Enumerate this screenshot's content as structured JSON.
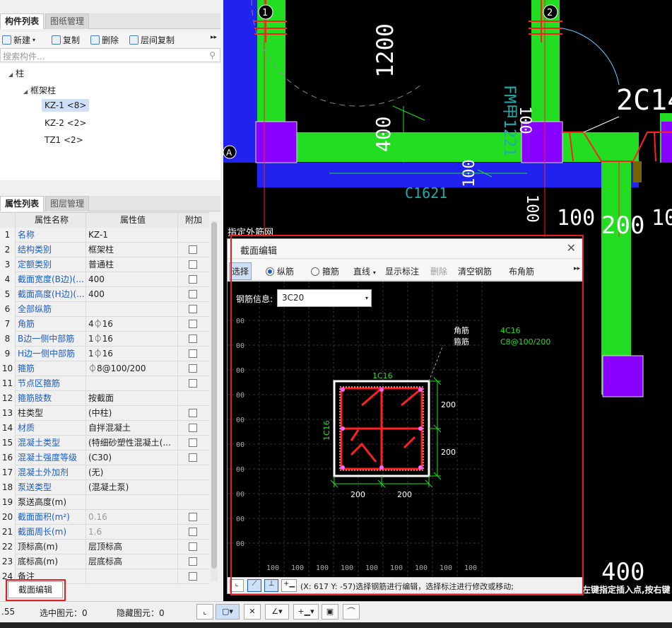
{
  "component_panel": {
    "tabs": [
      "构件列表",
      "图纸管理"
    ],
    "toolbar": {
      "new": "新建",
      "copy": "复制",
      "delete": "删除",
      "floor_copy": "层间复制"
    },
    "search_placeholder": "搜索构件...",
    "tree": {
      "root": "柱",
      "group": "框架柱",
      "items": [
        "KZ-1 <8>",
        "KZ-2 <2>",
        "TZ1 <2>"
      ]
    }
  },
  "property_panel": {
    "tabs": [
      "属性列表",
      "图层管理"
    ],
    "headers": [
      "属性名称",
      "属性值",
      "附加"
    ],
    "rows": [
      {
        "n": "1",
        "name": "名称",
        "value": "KZ-1",
        "blue": true,
        "chk": false
      },
      {
        "n": "2",
        "name": "结构类别",
        "value": "框架柱",
        "blue": true,
        "chk": true
      },
      {
        "n": "3",
        "name": "定额类别",
        "value": "普通柱",
        "blue": true,
        "chk": true
      },
      {
        "n": "4",
        "name": "截面宽度(B边)(...",
        "value": "400",
        "blue": true,
        "chk": true
      },
      {
        "n": "5",
        "name": "截面高度(H边)(...",
        "value": "400",
        "blue": true,
        "chk": true
      },
      {
        "n": "6",
        "name": "全部纵筋",
        "value": "",
        "blue": true,
        "chk": true
      },
      {
        "n": "7",
        "name": "角筋",
        "value": "4⏀16",
        "blue": true,
        "chk": true
      },
      {
        "n": "8",
        "name": "B边一侧中部筋",
        "value": "1⏀16",
        "blue": true,
        "chk": true
      },
      {
        "n": "9",
        "name": "H边一侧中部筋",
        "value": "1⏀16",
        "blue": true,
        "chk": true
      },
      {
        "n": "10",
        "name": "箍筋",
        "value": "⏀8@100/200",
        "blue": true,
        "chk": true
      },
      {
        "n": "11",
        "name": "节点区箍筋",
        "value": "",
        "blue": true,
        "chk": true
      },
      {
        "n": "12",
        "name": "箍筋肢数",
        "value": "按截面",
        "blue": true,
        "chk": false
      },
      {
        "n": "13",
        "name": "柱类型",
        "value": "(中柱)",
        "blue": false,
        "chk": true
      },
      {
        "n": "14",
        "name": "材质",
        "value": "自拌混凝土",
        "blue": true,
        "chk": true
      },
      {
        "n": "15",
        "name": "混凝土类型",
        "value": "(特细砂塑性混凝土(...",
        "blue": true,
        "chk": true
      },
      {
        "n": "16",
        "name": "混凝土强度等级",
        "value": "(C30)",
        "blue": true,
        "chk": true
      },
      {
        "n": "17",
        "name": "混凝土外加剂",
        "value": "(无)",
        "blue": true,
        "chk": false
      },
      {
        "n": "18",
        "name": "泵送类型",
        "value": "(混凝土泵)",
        "blue": true,
        "chk": false
      },
      {
        "n": "19",
        "name": "泵送高度(m)",
        "value": "",
        "blue": false,
        "chk": false
      },
      {
        "n": "20",
        "name": "截面面积(m²)",
        "value": "0.16",
        "blue": true,
        "chk": true,
        "gray": true
      },
      {
        "n": "21",
        "name": "截面周长(m)",
        "value": "1.6",
        "blue": true,
        "chk": true,
        "gray": true
      },
      {
        "n": "22",
        "name": "顶标高(m)",
        "value": "层顶标高",
        "blue": false,
        "chk": true
      },
      {
        "n": "23",
        "name": "底标高(m)",
        "value": "层底标高",
        "blue": false,
        "chk": true
      },
      {
        "n": "24",
        "name": "备注",
        "value": "",
        "blue": false,
        "chk": true
      }
    ],
    "footer_button": "截面编辑"
  },
  "status_bar": {
    "coord": ".55",
    "selected": "选中图元：0",
    "hidden": "隐藏图元：0"
  },
  "cad": {
    "axis_1": "1",
    "axis_2": "2",
    "axis_a": "A",
    "dim_1200": "1200",
    "label_fm": "FM甲1221",
    "label_2c14": "2C14",
    "dim_400": "400",
    "dim_100_a": "100",
    "dim_100_b": "100",
    "dim_100_c": "100",
    "label_c1621": "C1621",
    "dim_100_d": "100",
    "dim_200": "200",
    "dim_10": "10",
    "partial_text": "指定外筋网",
    "dim_400_b": "400",
    "status_text": "左键指定插入点,按右键"
  },
  "dialog": {
    "title": "截面编辑",
    "toolbar": {
      "select": "选择",
      "longitudinal": "纵筋",
      "stirrup": "箍筋",
      "line": "直线",
      "show_dims": "显示标注",
      "delete": "删除",
      "clear": "清空钢筋",
      "corner": "布角筋"
    },
    "rebar_info_label": "钢筋信息:",
    "rebar_info_value": "3C20",
    "legend_corner": "角筋",
    "legend_stirrup": "箍筋",
    "legend_corner_val": "4C16",
    "legend_stirrup_val": "C8@100/200",
    "top_label": "1C16",
    "side_label": "1C16",
    "dim_right_top": "200",
    "dim_right_bottom": "200",
    "dim_bottom_left": "200",
    "dim_bottom_right": "200",
    "grid_label": "00",
    "grid_bottom": "100",
    "hint": "(X: 617 Y: -57)选择钢筋进行编辑，选择标注进行修改或移动;"
  }
}
